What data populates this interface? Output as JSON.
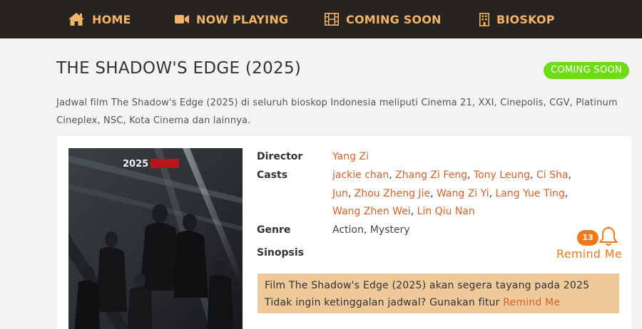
{
  "nav": {
    "items": [
      {
        "label": "HOME",
        "icon": "home-icon"
      },
      {
        "label": "NOW PLAYING",
        "icon": "video-camera-icon"
      },
      {
        "label": "COMING SOON",
        "icon": "film-icon"
      },
      {
        "label": "BIOSKOP",
        "icon": "building-icon"
      }
    ]
  },
  "movie": {
    "title": "THE SHADOW'S EDGE (2025)",
    "status": "COMING SOON",
    "intro": "Jadwal film The Shadow's Edge (2025) di seluruh bioskop Indonesia meliputi Cinema 21, XXI, Cinepolis, CGV, Platinum Cineplex, NSC, Kota Cinema dan lainnya.",
    "poster_text": "2025",
    "details": {
      "director_label": "Director",
      "director": "Yang Zi",
      "casts_label": "Casts",
      "casts": [
        "jackie chan",
        "Zhang Zi Feng",
        "Tony Leung",
        "Ci Sha",
        "Jun",
        "Zhou Zheng Jie",
        "Wang Zi Yi",
        "Lang Yue Ting",
        "Wang Zhen Wei",
        "Lin Qiu Nan"
      ],
      "genre_label": "Genre",
      "genre": "Action, Mystery",
      "sinopsis_label": "Sinopsis"
    },
    "remind": {
      "count": "13",
      "label": "Remind Me"
    },
    "notice": {
      "line1": "Film The Shadow's Edge (2025) akan segera tayang pada 2025",
      "line2_prefix": "Tidak ingin ketinggalan jadwal? Gunakan fitur ",
      "line2_link": "Remind Me"
    }
  },
  "colors": {
    "nav_bg": "#272320",
    "nav_text": "#f2b36b",
    "badge": "#6edc14",
    "link": "#d2622a",
    "remind": "#ec7a1c",
    "notice_bg": "#efc999"
  }
}
